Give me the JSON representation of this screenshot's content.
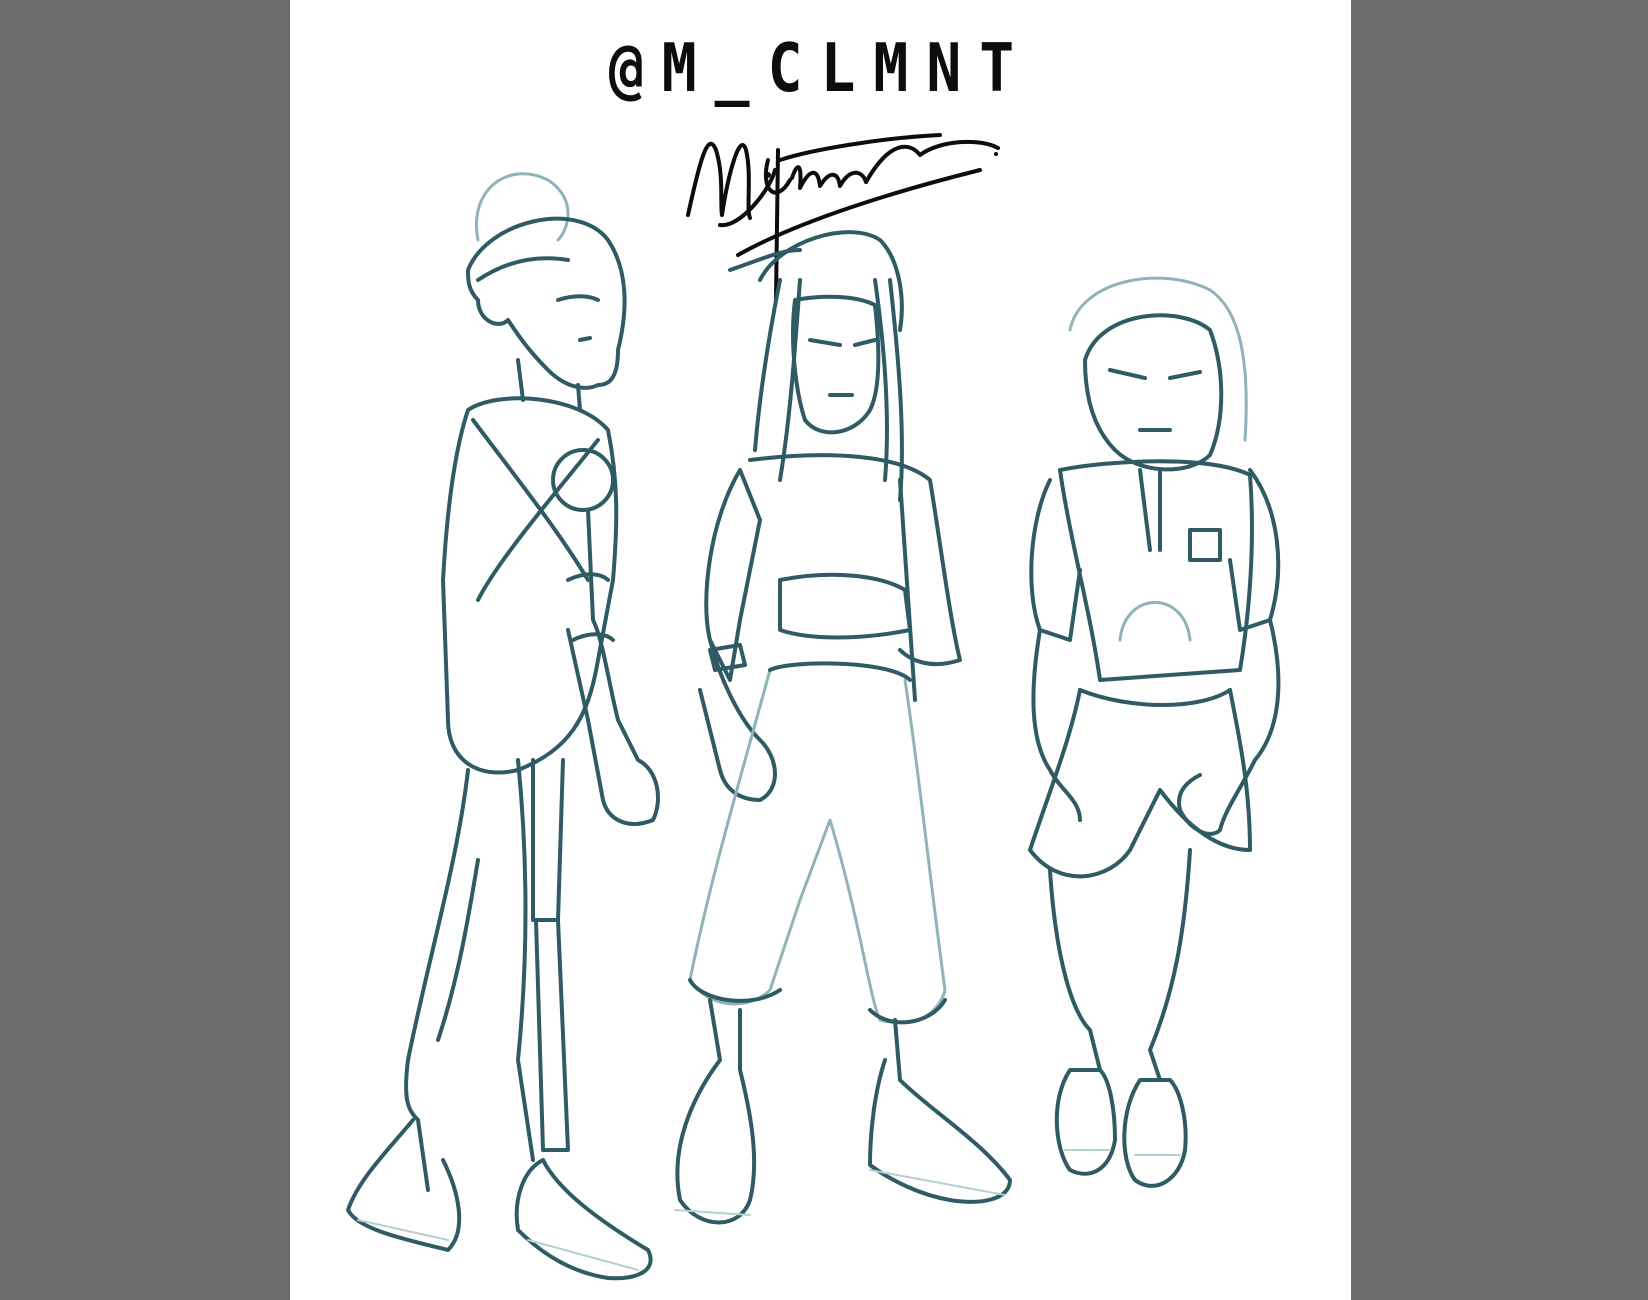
{
  "artwork": {
    "handle": "@M_CLMNT",
    "signature_text": "MClmnt",
    "colors": {
      "background": "#6d6d6d",
      "canvas": "#ffffff",
      "line_art": "#2f5b64",
      "sketch": "#8fb3b8",
      "signature_ink": "#0d0d0d"
    },
    "figures": [
      {
        "name": "figure-left",
        "description_icon": "standing-figure-icon"
      },
      {
        "name": "figure-center",
        "description_icon": "standing-figure-icon"
      },
      {
        "name": "figure-right",
        "description_icon": "standing-figure-icon"
      }
    ]
  }
}
